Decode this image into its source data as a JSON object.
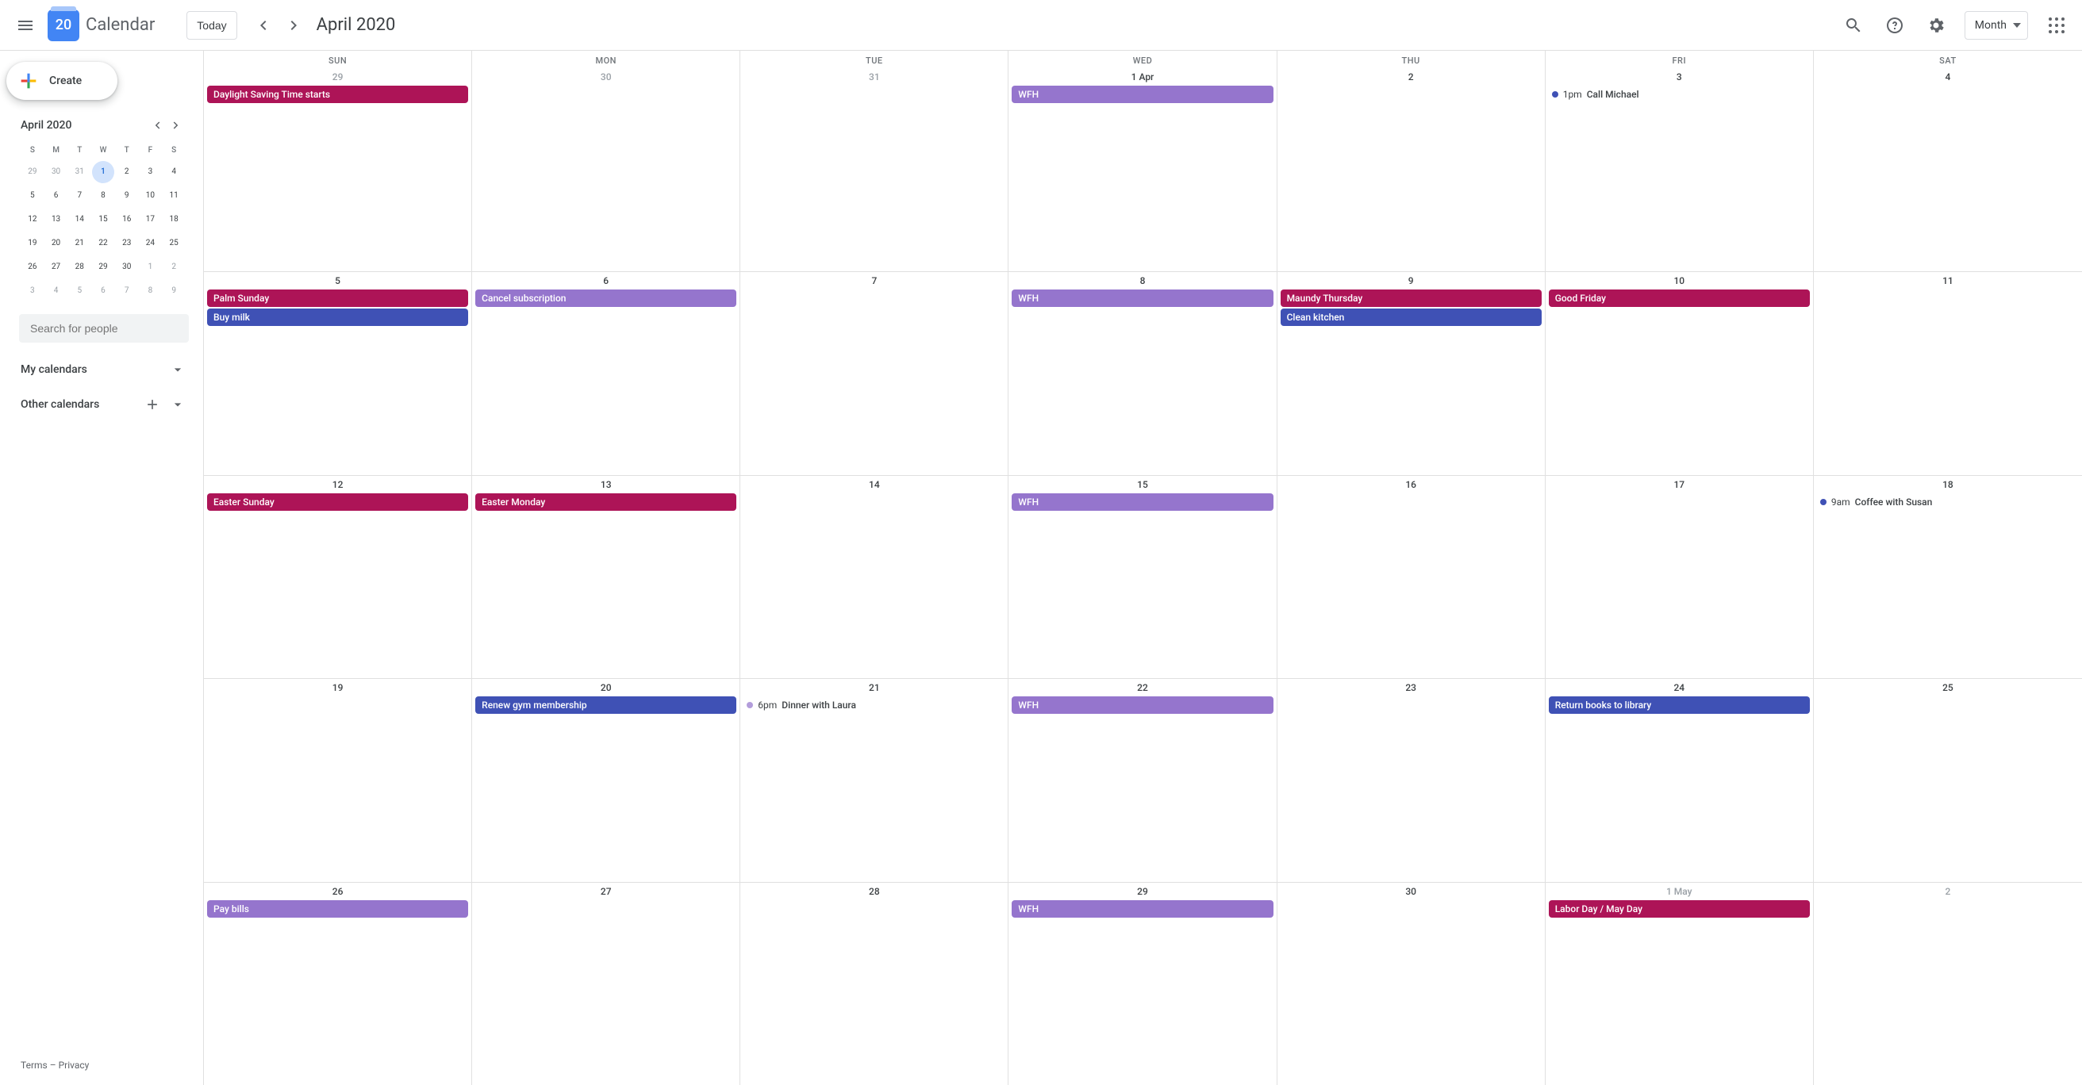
{
  "header": {
    "logo_day": "20",
    "app_title": "Calendar",
    "today_label": "Today",
    "period_title": "April 2020",
    "view_label": "Month"
  },
  "sidebar": {
    "create_label": "Create",
    "mini_title": "April 2020",
    "dow": [
      "S",
      "M",
      "T",
      "W",
      "T",
      "F",
      "S"
    ],
    "mini_days": [
      {
        "n": "29",
        "o": true
      },
      {
        "n": "30",
        "o": true
      },
      {
        "n": "31",
        "o": true
      },
      {
        "n": "1",
        "c": true
      },
      {
        "n": "2"
      },
      {
        "n": "3"
      },
      {
        "n": "4"
      },
      {
        "n": "5"
      },
      {
        "n": "6"
      },
      {
        "n": "7"
      },
      {
        "n": "8"
      },
      {
        "n": "9"
      },
      {
        "n": "10"
      },
      {
        "n": "11"
      },
      {
        "n": "12"
      },
      {
        "n": "13"
      },
      {
        "n": "14"
      },
      {
        "n": "15"
      },
      {
        "n": "16"
      },
      {
        "n": "17"
      },
      {
        "n": "18"
      },
      {
        "n": "19"
      },
      {
        "n": "20"
      },
      {
        "n": "21"
      },
      {
        "n": "22"
      },
      {
        "n": "23"
      },
      {
        "n": "24"
      },
      {
        "n": "25"
      },
      {
        "n": "26"
      },
      {
        "n": "27"
      },
      {
        "n": "28"
      },
      {
        "n": "29"
      },
      {
        "n": "30"
      },
      {
        "n": "1",
        "o": true
      },
      {
        "n": "2",
        "o": true
      },
      {
        "n": "3",
        "o": true
      },
      {
        "n": "4",
        "o": true
      },
      {
        "n": "5",
        "o": true
      },
      {
        "n": "6",
        "o": true
      },
      {
        "n": "7",
        "o": true
      },
      {
        "n": "8",
        "o": true
      },
      {
        "n": "9",
        "o": true
      }
    ],
    "search_placeholder": "Search for people",
    "my_calendars": "My calendars",
    "other_calendars": "Other calendars"
  },
  "calendar": {
    "dow": [
      "SUN",
      "MON",
      "TUE",
      "WED",
      "THU",
      "FRI",
      "SAT"
    ],
    "weeks": [
      [
        {
          "num": "29",
          "outside": true,
          "events": [
            {
              "type": "holiday",
              "title": "Daylight Saving Time starts"
            }
          ]
        },
        {
          "num": "30",
          "outside": true,
          "events": []
        },
        {
          "num": "31",
          "outside": true,
          "events": []
        },
        {
          "num": "1 Apr",
          "events": [
            {
              "type": "wfh",
              "title": "WFH"
            }
          ]
        },
        {
          "num": "2",
          "events": []
        },
        {
          "num": "3",
          "events": [
            {
              "type": "timed",
              "dot": "blue",
              "time": "1pm",
              "title": "Call Michael"
            }
          ]
        },
        {
          "num": "4",
          "events": []
        }
      ],
      [
        {
          "num": "5",
          "events": [
            {
              "type": "holiday",
              "title": "Palm Sunday"
            },
            {
              "type": "task",
              "title": "Buy milk"
            }
          ]
        },
        {
          "num": "6",
          "events": [
            {
              "type": "wfh",
              "title": "Cancel subscription"
            }
          ]
        },
        {
          "num": "7",
          "events": []
        },
        {
          "num": "8",
          "events": [
            {
              "type": "wfh",
              "title": "WFH"
            }
          ]
        },
        {
          "num": "9",
          "events": [
            {
              "type": "holiday",
              "title": "Maundy Thursday"
            },
            {
              "type": "task",
              "title": "Clean kitchen"
            }
          ]
        },
        {
          "num": "10",
          "events": [
            {
              "type": "holiday",
              "title": "Good Friday"
            }
          ]
        },
        {
          "num": "11",
          "events": []
        }
      ],
      [
        {
          "num": "12",
          "events": [
            {
              "type": "holiday",
              "title": "Easter Sunday"
            }
          ]
        },
        {
          "num": "13",
          "events": [
            {
              "type": "holiday",
              "title": "Easter Monday"
            }
          ]
        },
        {
          "num": "14",
          "events": []
        },
        {
          "num": "15",
          "events": [
            {
              "type": "wfh",
              "title": "WFH"
            }
          ]
        },
        {
          "num": "16",
          "events": []
        },
        {
          "num": "17",
          "events": []
        },
        {
          "num": "18",
          "events": [
            {
              "type": "timed",
              "dot": "blue",
              "time": "9am",
              "title": "Coffee with Susan"
            }
          ]
        }
      ],
      [
        {
          "num": "19",
          "events": []
        },
        {
          "num": "20",
          "events": [
            {
              "type": "task",
              "title": "Renew gym membership"
            }
          ]
        },
        {
          "num": "21",
          "events": [
            {
              "type": "timed",
              "dot": "purple",
              "time": "6pm",
              "title": "Dinner with Laura"
            }
          ]
        },
        {
          "num": "22",
          "events": [
            {
              "type": "wfh",
              "title": "WFH"
            }
          ]
        },
        {
          "num": "23",
          "events": []
        },
        {
          "num": "24",
          "events": [
            {
              "type": "task",
              "title": "Return books to library"
            }
          ]
        },
        {
          "num": "25",
          "events": []
        }
      ],
      [
        {
          "num": "26",
          "events": [
            {
              "type": "wfh",
              "title": "Pay bills"
            }
          ]
        },
        {
          "num": "27",
          "events": []
        },
        {
          "num": "28",
          "events": []
        },
        {
          "num": "29",
          "events": [
            {
              "type": "wfh",
              "title": "WFH"
            }
          ]
        },
        {
          "num": "30",
          "events": []
        },
        {
          "num": "1 May",
          "outside": true,
          "events": [
            {
              "type": "holiday",
              "title": "Labor Day / May Day"
            }
          ]
        },
        {
          "num": "2",
          "outside": true,
          "events": []
        }
      ]
    ]
  },
  "footer": {
    "terms": "Terms",
    "sep": " – ",
    "privacy": "Privacy"
  }
}
